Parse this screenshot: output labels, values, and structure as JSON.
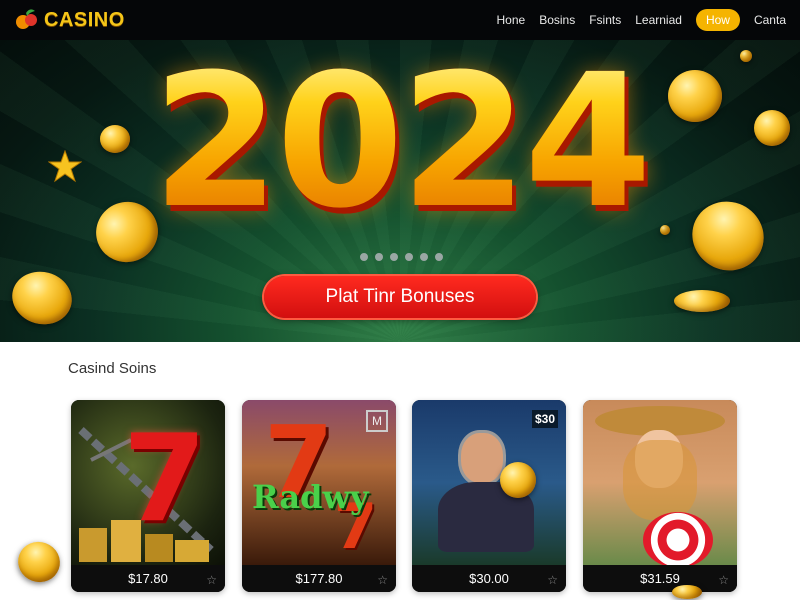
{
  "header": {
    "logo_text": "CASINO",
    "nav": [
      {
        "label": "Hone",
        "active": false
      },
      {
        "label": "Bosins",
        "active": false
      },
      {
        "label": "Fsints",
        "active": false
      },
      {
        "label": "Learniad",
        "active": false
      },
      {
        "label": "How",
        "active": true
      },
      {
        "label": "Canta",
        "active": false
      }
    ]
  },
  "hero": {
    "year": "2024",
    "cta_label": "Plat Tinr Bonuses",
    "slide_count": 6
  },
  "section": {
    "title": "Casind Soins"
  },
  "games": [
    {
      "price": "$17.80",
      "art": "red-seven-chains",
      "overlay": ""
    },
    {
      "price": "$177.80",
      "art": "crazy-seven",
      "overlay": "Radwy",
      "badge": "M"
    },
    {
      "price": "$30.00",
      "art": "gold-miner",
      "overlay": "",
      "badge": "$30"
    },
    {
      "price": "$31.59",
      "art": "cowgirl",
      "overlay": ""
    }
  ],
  "colors": {
    "accent": "#f5b400",
    "cta": "#e01a14",
    "header_bg": "#050608",
    "logo": "#f5c518"
  }
}
